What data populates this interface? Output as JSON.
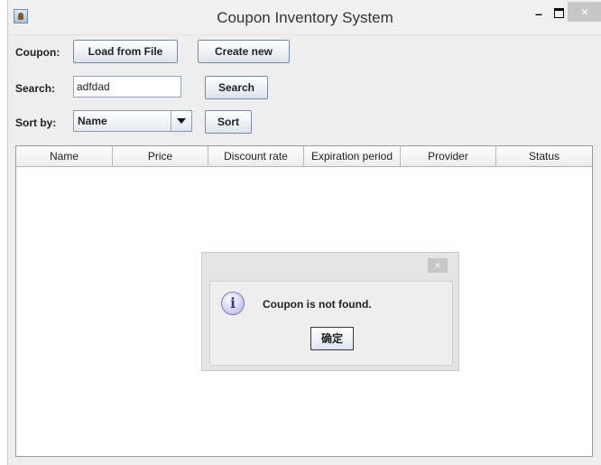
{
  "window": {
    "title": "Coupon Inventory System",
    "minimize_glyph": "–",
    "close_glyph": "×"
  },
  "coupon_row": {
    "label": "Coupon:",
    "load_button": "Load from File",
    "create_button": "Create new"
  },
  "search_row": {
    "label": "Search:",
    "value": "adfdad",
    "button": "Search"
  },
  "sort_row": {
    "label": "Sort by:",
    "selected": "Name",
    "button": "Sort"
  },
  "table": {
    "columns": [
      "Name",
      "Price",
      "Discount rate",
      "Expiration period",
      "Provider",
      "Status"
    ]
  },
  "dialog": {
    "close_glyph": "×",
    "icon_glyph": "i",
    "message": "Coupon is not found.",
    "ok_button": "确定"
  }
}
